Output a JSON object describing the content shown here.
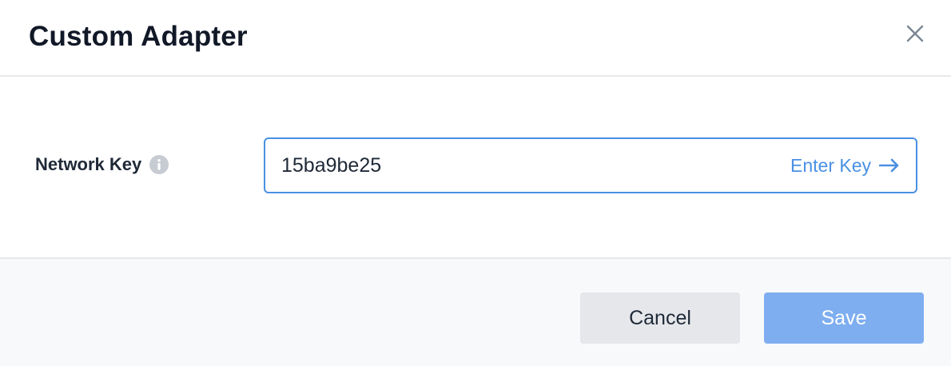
{
  "dialog": {
    "title": "Custom Adapter"
  },
  "form": {
    "network_key_label": "Network Key",
    "network_key_value": "15ba9be25",
    "enter_key_label": "Enter Key"
  },
  "footer": {
    "cancel_label": "Cancel",
    "save_label": "Save"
  },
  "colors": {
    "accent": "#4a90e2",
    "save_disabled": "#7eaef0",
    "cancel_bg": "#e5e7eb",
    "title": "#111827"
  },
  "icons": {
    "close": "close-icon",
    "info": "info-icon",
    "arrow": "arrow-right-icon"
  }
}
